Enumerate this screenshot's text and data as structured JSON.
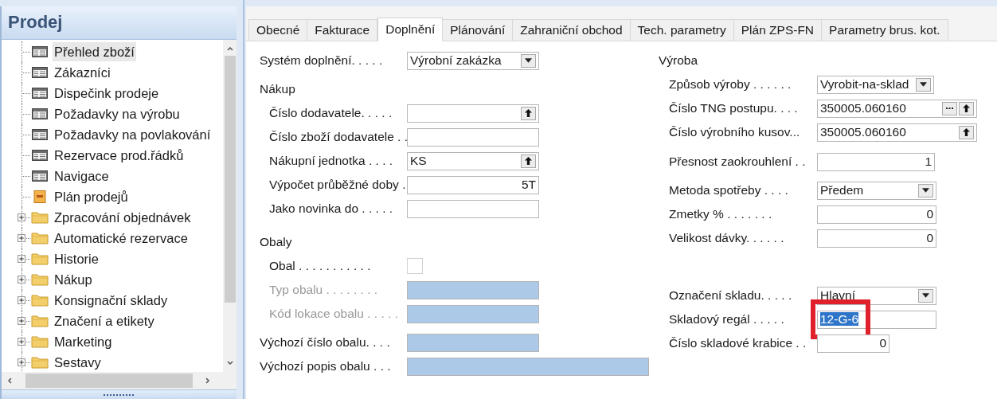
{
  "navigation_pane": {
    "title": "Prodej",
    "items": [
      {
        "label": "Přehled zboží",
        "kind": "form",
        "selected": true
      },
      {
        "label": "Zákazníci",
        "kind": "form",
        "selected": false
      },
      {
        "label": "Dispečink prodeje",
        "kind": "form",
        "selected": false
      },
      {
        "label": "Požadavky na výrobu",
        "kind": "form",
        "selected": false
      },
      {
        "label": "Požadavky na povlakování",
        "kind": "form",
        "selected": false
      },
      {
        "label": "Rezervace prod.řádků",
        "kind": "form",
        "selected": false
      },
      {
        "label": "Navigace",
        "kind": "form",
        "selected": false
      },
      {
        "label": "Plán prodejů",
        "kind": "report",
        "selected": false
      },
      {
        "label": "Zpracování objednávek",
        "kind": "folder",
        "selected": false
      },
      {
        "label": "Automatické rezervace",
        "kind": "folder",
        "selected": false
      },
      {
        "label": "Historie",
        "kind": "folder",
        "selected": false
      },
      {
        "label": "Nákup",
        "kind": "folder",
        "selected": false
      },
      {
        "label": "Konsignační sklady",
        "kind": "folder",
        "selected": false
      },
      {
        "label": "Značení a etikety",
        "kind": "folder",
        "selected": false
      },
      {
        "label": "Marketing",
        "kind": "folder",
        "selected": false
      },
      {
        "label": "Sestavy",
        "kind": "folder",
        "selected": false
      }
    ]
  },
  "tabs": [
    {
      "label": "Obecné",
      "selected": false
    },
    {
      "label": "Fakturace",
      "selected": false
    },
    {
      "label": "Doplnění",
      "selected": true
    },
    {
      "label": "Plánování",
      "selected": false
    },
    {
      "label": "Zahraniční obchod",
      "selected": false
    },
    {
      "label": "Tech. parametry",
      "selected": false
    },
    {
      "label": "Plán ZPS-FN",
      "selected": false
    },
    {
      "label": "Parametry brus. kot.",
      "selected": false
    }
  ],
  "columns": [
    [
      {
        "fields": [
          {
            "label": "Systém doplnění. . . . .",
            "value": "Výrobní zakázka",
            "kind": "dropdown"
          }
        ]
      },
      {
        "heading": "Nákup",
        "fields": [
          {
            "label": "Číslo dodavatele. . . . .",
            "kind": "lookup"
          },
          {
            "label": "Číslo zboží dodavatele . .",
            "kind": "text"
          },
          {
            "label": "Nákupní jednotka . . . .",
            "value": "KS",
            "kind": "lookup"
          },
          {
            "label": "Výpočet průběžné doby .",
            "value": "5T",
            "kind": "number"
          },
          {
            "label": "Jako novinka do . . . . .",
            "kind": "text"
          }
        ]
      },
      {
        "heading": "Obaly",
        "fields": [
          {
            "label": "Obal . . . . . . . . . . .",
            "kind": "checkbox",
            "checked": false,
            "disabled": false
          },
          {
            "label": "Typ obalu . . . . . . . .",
            "kind": "text",
            "disabled": true,
            "readonly": true
          },
          {
            "label": "Kód lokace obalu . . . . .",
            "kind": "text",
            "disabled": true,
            "readonly": true
          }
        ]
      },
      {
        "fields": [
          {
            "label": "Výchozí číslo obalu. . . .",
            "kind": "text",
            "disabled": false,
            "readonly": true
          },
          {
            "label": "Výchozí popis obalu . . .",
            "kind": "text",
            "disabled": false,
            "readonly": true
          }
        ]
      }
    ],
    [
      {
        "heading": "Výroba",
        "fields": [
          {
            "label": "Způsob výroby . . . . . .",
            "value": "Vyrobit-na-sklad",
            "kind": "dropdown"
          },
          {
            "label": "Číslo TNG postupu. . . .",
            "value": "350005.060160",
            "kind": "lookup_dots"
          },
          {
            "label": "Číslo výrobního kusov...",
            "value": "350005.060160",
            "kind": "lookup"
          }
        ]
      },
      {
        "fields": [
          {
            "label": "Přesnost zaokrouhlení . .",
            "value": "1",
            "kind": "number"
          }
        ]
      },
      {
        "fields": [
          {
            "label": "Metoda spotřeby . . . .",
            "value": "Předem",
            "kind": "dropdown"
          },
          {
            "label": "Zmetky % . . . . . . .",
            "value": "0",
            "kind": "number"
          },
          {
            "label": "Velikost dávky. . . . . .",
            "value": "0",
            "kind": "number"
          }
        ]
      },
      {
        "fields": [
          {
            "label": "Označení skladu. . . . .",
            "value": "Hlavní",
            "kind": "dropdown"
          },
          {
            "label": "Skladový regál . . . . .",
            "value": "12-G-6",
            "kind": "text",
            "text_selected": true,
            "highlighted": true
          },
          {
            "label": "Číslo skladové krabice . .",
            "value": "0",
            "kind": "number"
          }
        ]
      }
    ]
  ]
}
